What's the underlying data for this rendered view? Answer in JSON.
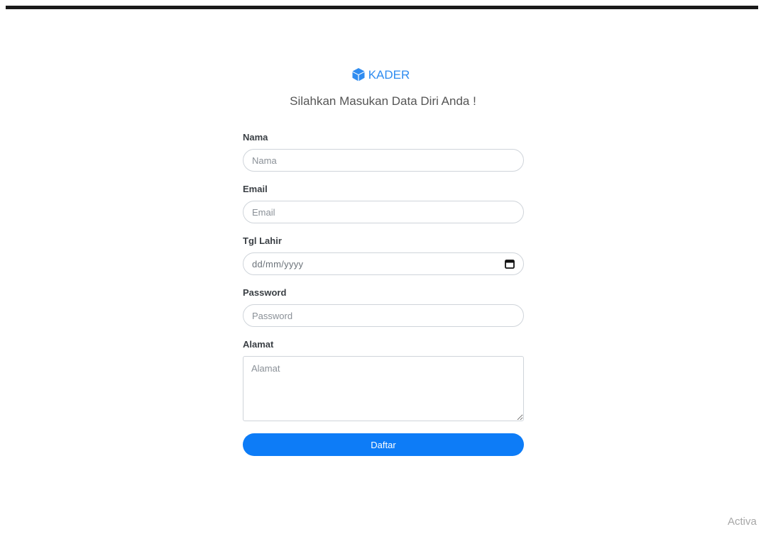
{
  "brand": {
    "icon": "cube-icon",
    "name": "KADER",
    "color": "#2f8cf0"
  },
  "subtitle": "Silahkan Masukan Data Diri Anda !",
  "form": {
    "nama": {
      "label": "Nama",
      "placeholder": "Nama",
      "value": ""
    },
    "email": {
      "label": "Email",
      "placeholder": "Email",
      "value": ""
    },
    "tgl_lahir": {
      "label": "Tgl Lahir",
      "display": "dd/mm/yyyy",
      "icon": "calendar-icon"
    },
    "password": {
      "label": "Password",
      "placeholder": "Password",
      "value": ""
    },
    "alamat": {
      "label": "Alamat",
      "placeholder": "Alamat",
      "value": ""
    },
    "submit_label": "Daftar"
  },
  "watermark": "Activa",
  "colors": {
    "primary": "#0d7cf7",
    "top_bar": "#1a1a1a"
  }
}
